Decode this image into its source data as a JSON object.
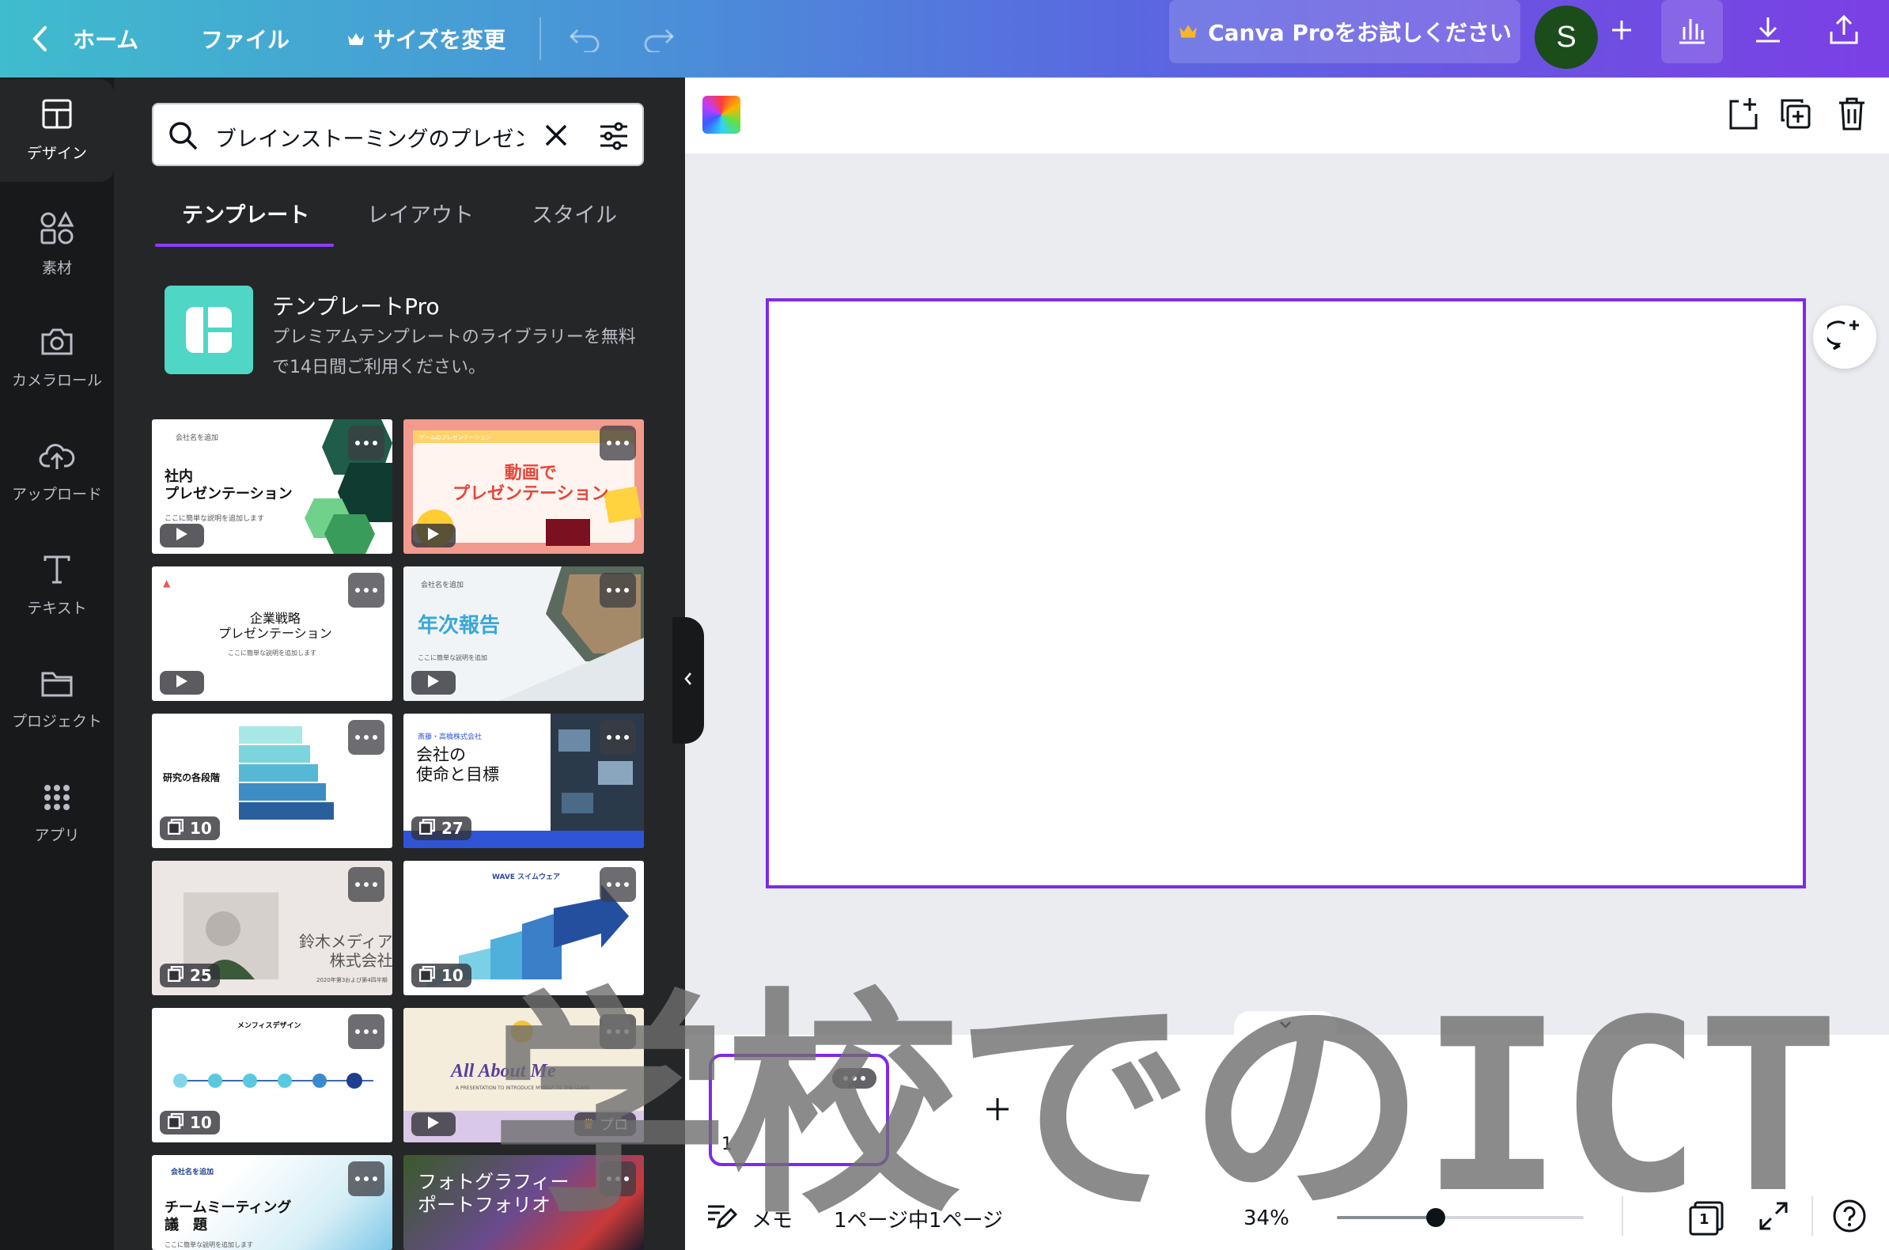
{
  "topbar": {
    "home_label": "ホーム",
    "file_label": "ファイル",
    "resize_label": "サイズを変更",
    "pro_label": "Canva Proをお試しください",
    "avatar_letter": "S"
  },
  "sidebar": {
    "items": [
      {
        "label": "デザイン",
        "icon": "layout-icon"
      },
      {
        "label": "素材",
        "icon": "shapes-icon"
      },
      {
        "label": "カメラロール",
        "icon": "camera-icon"
      },
      {
        "label": "アップロード",
        "icon": "cloud-upload-icon"
      },
      {
        "label": "テキスト",
        "icon": "text-icon"
      },
      {
        "label": "プロジェクト",
        "icon": "folder-icon"
      },
      {
        "label": "アプリ",
        "icon": "apps-grid-icon"
      }
    ]
  },
  "panel": {
    "search_value": "ブレインストーミングのプレゼン",
    "tabs": [
      "テンプレート",
      "レイアウト",
      "スタイル"
    ],
    "pro_card": {
      "title": "テンプレートPro",
      "description": "プレミアムテンプレートのライブラリーを無料で14日間ご利用ください。"
    },
    "templates": [
      {
        "title": "社内\nプレゼンテーション",
        "subtitle": "ここに簡単な説明を追加します",
        "corner": "会社名を追加",
        "badge": "play"
      },
      {
        "title": "動画で\nプレゼンテーション",
        "corner": "ゲームのプレゼンテーション",
        "badge": "play"
      },
      {
        "title": "企業戦略\nプレゼンテーション",
        "subtitle": "ここに簡単な説明を追加します",
        "badge": "play"
      },
      {
        "title": "年次報告",
        "subtitle": "ここに簡単な説明を追加",
        "corner": "会社名を追加",
        "badge": "play"
      },
      {
        "title": "研究の各段階",
        "badge": "10"
      },
      {
        "title": "会社の\n使命と目標",
        "corner": "斎藤・高橋株式会社",
        "badge": "27"
      },
      {
        "title": "鈴木メディア\n株式会社",
        "subtitle": "2020年第3および第4四半期",
        "badge": "25"
      },
      {
        "title": "WAVE スイムウェア",
        "badge": "10"
      },
      {
        "title": "メンフィスデザイン",
        "badge": "10"
      },
      {
        "title": "All About Me",
        "subtitle": "A PRESENTATION TO INTRODUCE MYSELF TO THE CLASS",
        "badge": "play",
        "pro": "プロ"
      },
      {
        "title": "チームミーティング\n議　題",
        "subtitle": "ここに簡単な説明を追加します",
        "corner": "会社名を追加"
      },
      {
        "title": "フォトグラフィー\nポートフォリオ"
      }
    ]
  },
  "bottom": {
    "page_number": "1",
    "notes_label": "メモ",
    "page_info": "1ページ中1ページ",
    "zoom": "34%",
    "zoom_fraction": 0.4,
    "page_count": "1"
  },
  "watermark": "学校でのICT"
}
